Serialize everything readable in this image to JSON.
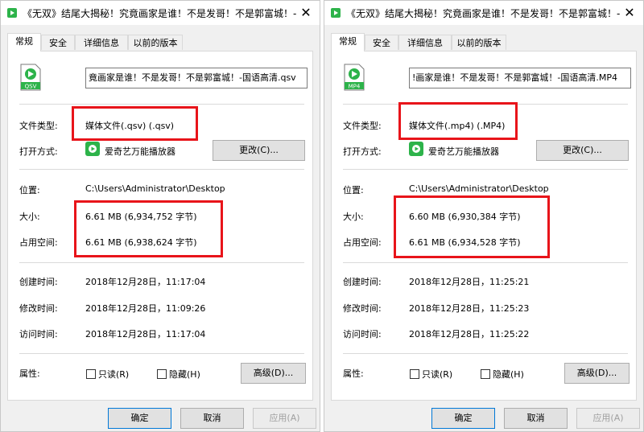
{
  "tabs": [
    "常规",
    "安全",
    "详细信息",
    "以前的版本"
  ],
  "labels": {
    "file_type": "文件类型:",
    "open_with": "打开方式:",
    "location": "位置:",
    "size": "大小:",
    "size_on_disk": "占用空间:",
    "created": "创建时间:",
    "modified": "修改时间:",
    "accessed": "访问时间:",
    "attributes": "属性:"
  },
  "buttons": {
    "change": "更改(C)...",
    "advanced": "高级(D)...",
    "ok": "确定",
    "cancel": "取消",
    "apply": "应用(A)"
  },
  "attributes": {
    "readonly": "只读(R)",
    "hidden": "隐藏(H)"
  },
  "colors": {
    "highlight": "#e8141a",
    "player_green": "#2db34a"
  },
  "windows": [
    {
      "title": "《无双》结尾大揭秘！究竟画家是谁！不是发哥！不是郭富城！-",
      "filename": "竟画家是谁！不是发哥！不是郭富城！-国语高清.qsv",
      "icon_label": "QSV",
      "file_type": "媒体文件(.qsv) (.qsv)",
      "open_with": "爱奇艺万能播放器",
      "location": "C:\\Users\\Administrator\\Desktop",
      "size": "6.61 MB (6,934,752 字节)",
      "size_on_disk": "6.61 MB (6,938,624 字节)",
      "created": "2018年12月28日，11:17:04",
      "modified": "2018年12月28日，11:09:26",
      "accessed": "2018年12月28日，11:17:04"
    },
    {
      "title": "《无双》结尾大揭秘！究竟画家是谁！不是发哥！不是郭富城！-",
      "filename": "!画家是谁！不是发哥！不是郭富城！-国语高清.MP4",
      "icon_label": "MP4",
      "file_type": "媒体文件(.mp4) (.MP4)",
      "open_with": "爱奇艺万能播放器",
      "location": "C:\\Users\\Administrator\\Desktop",
      "size": "6.60 MB (6,930,384 字节)",
      "size_on_disk": "6.61 MB (6,934,528 字节)",
      "created": "2018年12月28日，11:25:21",
      "modified": "2018年12月28日，11:25:23",
      "accessed": "2018年12月28日，11:25:22"
    }
  ]
}
